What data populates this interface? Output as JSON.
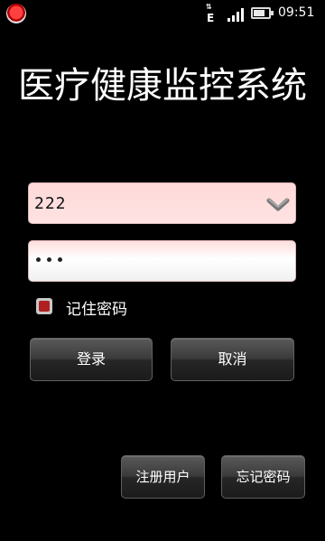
{
  "status_bar": {
    "network_type": "E",
    "time": "09:51"
  },
  "app": {
    "title": "医疗健康监控系统"
  },
  "form": {
    "username_value": "222",
    "password_masked": "•••",
    "remember_label": "记住密码",
    "remember_checked": true
  },
  "buttons": {
    "login": "登录",
    "cancel": "取消",
    "register": "注册用户",
    "forgot_password": "忘记密码"
  },
  "colors": {
    "background": "#000000",
    "input_bg": "#ffd9d9",
    "checkbox_fill": "#b02020",
    "button_gradient_top": "#5a5a5a",
    "button_gradient_bottom": "#1b1b1b"
  },
  "icons": [
    "record-icon",
    "edge-data-icon",
    "signal-icon",
    "battery-icon",
    "dropdown-chevron-icon",
    "checkbox-icon"
  ]
}
